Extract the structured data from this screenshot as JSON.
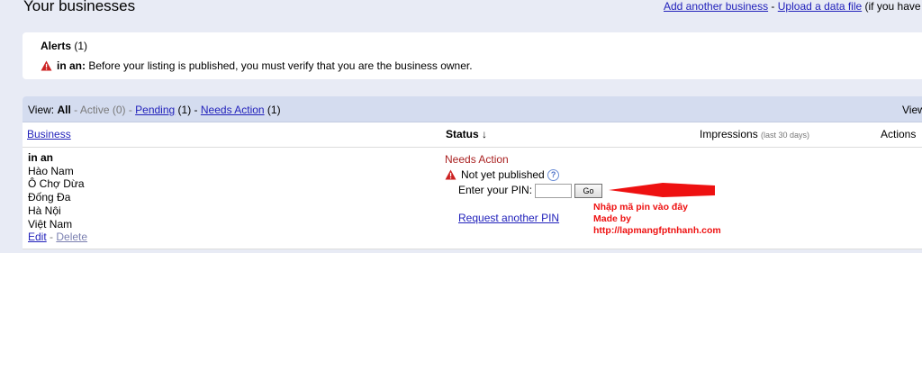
{
  "header": {
    "title": "Your businesses",
    "add_link": "Add another business",
    "separator": " - ",
    "upload_link": "Upload a data file",
    "upload_trailing": " (if you have"
  },
  "alerts": {
    "title": "Alerts",
    "count": " (1)",
    "item_name": "in an:",
    "item_text": " Before your listing is published, you must verify that you are the business owner."
  },
  "viewbar": {
    "prefix": "View: ",
    "all": "All",
    "active": " - Active (0) - ",
    "pending": "Pending",
    "pending_count": " (1) - ",
    "needs_action": "Needs Action",
    "needs_count": " (1)",
    "right_label": "View"
  },
  "table": {
    "col_business": "Business",
    "col_status": "Status ↓",
    "col_impressions": "Impressions",
    "col_impressions_note": "(last 30 days)",
    "col_actions": "Actions",
    "row": {
      "name": "in an",
      "address_lines": [
        "Hào Nam",
        "Ô Chợ Dừa",
        "Đống Đa",
        "Hà Nội",
        "Việt Nam"
      ],
      "edit": "Edit",
      "sep": " - ",
      "delete": "Delete",
      "status": "Needs Action",
      "publish_state": "Not yet published",
      "help": "?",
      "pin_label": "Enter your PIN:",
      "pin_value": "",
      "go": "Go",
      "request_pin": "Request another PIN"
    }
  },
  "annotation": {
    "line1": "Nhập mã pin vào đây",
    "line2": "Made by",
    "line3": "http://lapmangfptnhanh.com",
    "color": "#ee1111"
  }
}
